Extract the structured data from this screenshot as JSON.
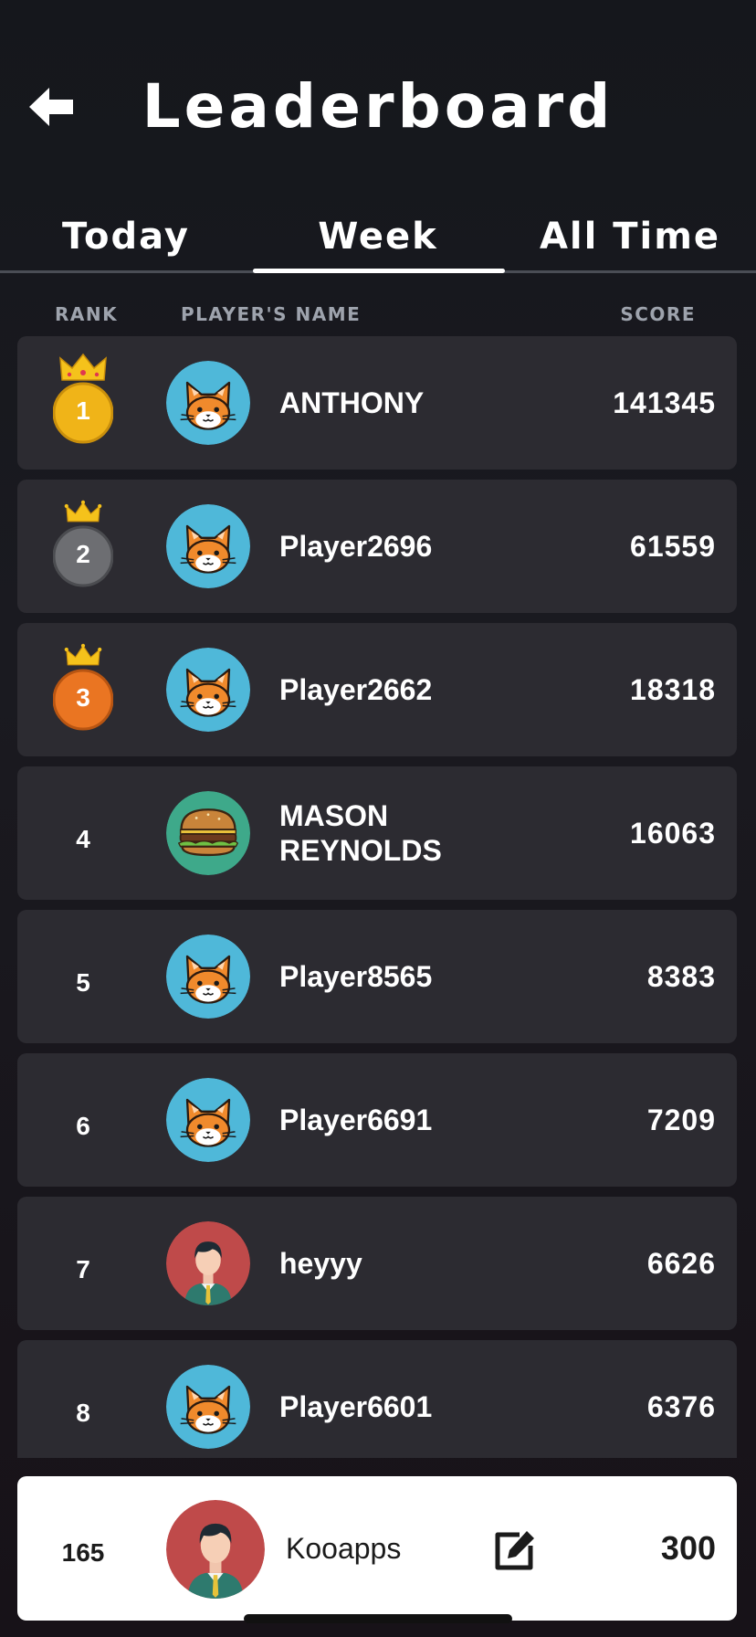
{
  "header": {
    "title": "Leaderboard",
    "back_icon": "back-arrow-icon"
  },
  "tabs": [
    {
      "label": "Today",
      "selected": false
    },
    {
      "label": "Week",
      "selected": true
    },
    {
      "label": "All Time",
      "selected": false
    }
  ],
  "columns": {
    "rank": "RANK",
    "name": "PLAYER'S NAME",
    "score": "SCORE"
  },
  "rows": [
    {
      "rank": "1",
      "name": "ANTHONY",
      "score": "141345",
      "avatar": "cat-avatar-icon",
      "medal": "gold"
    },
    {
      "rank": "2",
      "name": "Player2696",
      "score": "61559",
      "avatar": "cat-avatar-icon",
      "medal": "silver"
    },
    {
      "rank": "3",
      "name": "Player2662",
      "score": "18318",
      "avatar": "cat-avatar-icon",
      "medal": "bronze"
    },
    {
      "rank": "4",
      "name": "MASON REYNOLDS",
      "score": "16063",
      "avatar": "burger-avatar-icon"
    },
    {
      "rank": "5",
      "name": "Player8565",
      "score": "8383",
      "avatar": "cat-avatar-icon"
    },
    {
      "rank": "6",
      "name": "Player6691",
      "score": "7209",
      "avatar": "cat-avatar-icon"
    },
    {
      "rank": "7",
      "name": "heyyy",
      "score": "6626",
      "avatar": "person-avatar-icon"
    },
    {
      "rank": "8",
      "name": "Player6601",
      "score": "6376",
      "avatar": "cat-avatar-icon"
    }
  ],
  "current_user": {
    "rank": "165",
    "name": "Kooapps",
    "score": "300",
    "avatar": "person-avatar-icon",
    "edit_icon": "edit-icon"
  },
  "colors": {
    "gold": "#f0b418",
    "silver": "#6d6e72",
    "bronze": "#ea7522",
    "crown": "#f5c21b",
    "row_bg": "#2c2b31",
    "cat_bg": "#4fb8d9",
    "burger_bg": "#3ea98a",
    "person_bg": "#bf4a4a"
  }
}
